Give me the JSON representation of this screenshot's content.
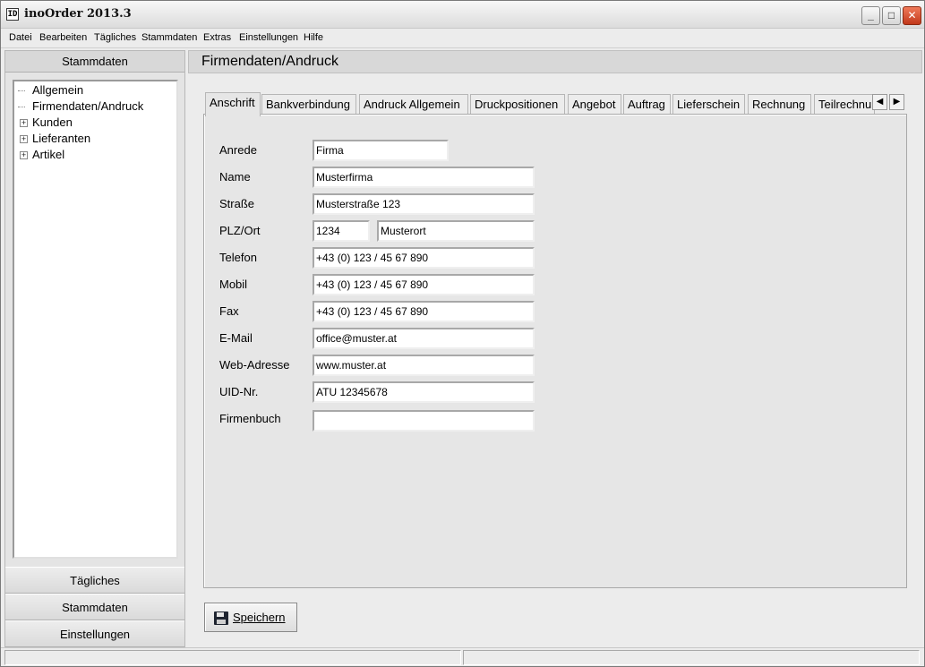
{
  "window": {
    "title": "inoOrder 2013.3",
    "controls": {
      "minimize": "_",
      "maximize": "□",
      "close": "✕"
    }
  },
  "menu": [
    "Datei",
    "Bearbeiten",
    "Tägliches",
    "Stammdaten",
    "Extras",
    "Einstellungen",
    "Hilfe"
  ],
  "sidebar": {
    "header": "Stammdaten",
    "tree": [
      {
        "label": "Allgemein",
        "expandable": false
      },
      {
        "label": "Firmendaten/Andruck",
        "expandable": false
      },
      {
        "label": "Kunden",
        "expandable": true
      },
      {
        "label": "Lieferanten",
        "expandable": true
      },
      {
        "label": "Artikel",
        "expandable": true
      }
    ],
    "sections": [
      "Tägliches",
      "Stammdaten",
      "Einstellungen"
    ]
  },
  "main": {
    "title": "Firmendaten/Andruck",
    "tabs": [
      "Anschrift",
      "Bankverbindung",
      "Andruck Allgemein",
      "Druckpositionen",
      "Angebot",
      "Auftrag",
      "Lieferschein",
      "Rechnung",
      "Teilrechnu"
    ],
    "active_tab": "Anschrift",
    "tab_scroll": {
      "left": "◀",
      "right": "▶"
    },
    "form": {
      "anrede": {
        "label": "Anrede",
        "value": "Firma"
      },
      "name": {
        "label": "Name",
        "value": "Musterfirma"
      },
      "strasse": {
        "label": "Straße",
        "value": "Musterstraße 123"
      },
      "plz_ort": {
        "label": "PLZ/Ort",
        "plz": "1234",
        "ort": "Musterort"
      },
      "telefon": {
        "label": "Telefon",
        "value": "+43 (0) 123 / 45 67 890"
      },
      "mobil": {
        "label": "Mobil",
        "value": "+43 (0) 123 / 45 67 890"
      },
      "fax": {
        "label": "Fax",
        "value": "+43 (0) 123 / 45 67 890"
      },
      "email": {
        "label": "E-Mail",
        "value": "office@muster.at"
      },
      "web": {
        "label": "Web-Adresse",
        "value": "www.muster.at"
      },
      "uid": {
        "label": "UID-Nr.",
        "value": "ATU 12345678"
      },
      "firmenbuch": {
        "label": "Firmenbuch",
        "value": ""
      }
    },
    "save_button": {
      "label": "Speichern",
      "icon": "floppy-disk-icon"
    }
  },
  "colors": {
    "window_bg": "#ececec",
    "close_button": "#c1381a"
  }
}
